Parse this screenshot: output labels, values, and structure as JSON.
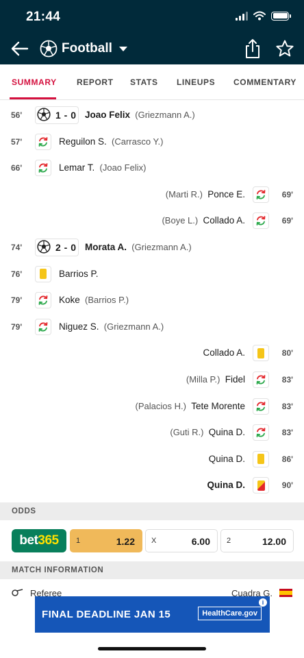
{
  "status_bar": {
    "time": "21:44"
  },
  "header": {
    "title": "Football"
  },
  "tabs": [
    "SUMMARY",
    "REPORT",
    "STATS",
    "LINEUPS",
    "COMMENTARY"
  ],
  "events": [
    {
      "minute": "56'",
      "side": "home",
      "type": "goal",
      "score": "1 - 0",
      "player": "Joao Felix",
      "assist": "(Griezmann A.)"
    },
    {
      "minute": "57'",
      "side": "home",
      "type": "substitution",
      "player": "Reguilon S.",
      "assist": "(Carrasco Y.)"
    },
    {
      "minute": "66'",
      "side": "home",
      "type": "substitution",
      "player": "Lemar T.",
      "assist": "(Joao Felix)"
    },
    {
      "minute": "69'",
      "side": "away",
      "type": "substitution",
      "player": "Ponce E.",
      "assist": "(Marti R.)"
    },
    {
      "minute": "69'",
      "side": "away",
      "type": "substitution",
      "player": "Collado A.",
      "assist": "(Boye L.)"
    },
    {
      "minute": "74'",
      "side": "home",
      "type": "goal",
      "score": "2 - 0",
      "player": "Morata A.",
      "assist": "(Griezmann A.)"
    },
    {
      "minute": "76'",
      "side": "home",
      "type": "yellow-card",
      "player": "Barrios P.",
      "assist": ""
    },
    {
      "minute": "79'",
      "side": "home",
      "type": "substitution",
      "player": "Koke",
      "assist": "(Barrios P.)"
    },
    {
      "minute": "79'",
      "side": "home",
      "type": "substitution",
      "player": "Niguez S.",
      "assist": "(Griezmann A.)"
    },
    {
      "minute": "80'",
      "side": "away",
      "type": "yellow-card",
      "player": "Collado A.",
      "assist": ""
    },
    {
      "minute": "83'",
      "side": "away",
      "type": "substitution",
      "player": "Fidel",
      "assist": "(Milla P.)"
    },
    {
      "minute": "83'",
      "side": "away",
      "type": "substitution",
      "player": "Tete Morente",
      "assist": "(Palacios H.)"
    },
    {
      "minute": "83'",
      "side": "away",
      "type": "substitution",
      "player": "Quina D.",
      "assist": "(Guti R.)"
    },
    {
      "minute": "86'",
      "side": "away",
      "type": "yellow-card",
      "player": "Quina D.",
      "assist": ""
    },
    {
      "minute": "90'",
      "side": "away",
      "type": "red-card",
      "player": "Quina D.",
      "assist": ""
    }
  ],
  "odds": {
    "heading": "ODDS",
    "bookmaker": {
      "part1": "bet",
      "part2": "365"
    },
    "options": [
      {
        "key": "1",
        "value": "1.22"
      },
      {
        "key": "X",
        "value": "6.00"
      },
      {
        "key": "2",
        "value": "12.00"
      }
    ]
  },
  "match_info": {
    "heading": "MATCH INFORMATION",
    "referee_label": "Referee",
    "referee_name": "Cuadra G."
  },
  "ad": {
    "text": "FINAL DEADLINE JAN 15",
    "brand": "HealthCare.gov",
    "info": "i"
  },
  "colors": {
    "header_bg": "#012a3a",
    "accent": "#d4103e",
    "bookmaker_bg": "#087f5b",
    "best_odd": "#f0b95a",
    "ad_bg": "#1556b8"
  }
}
